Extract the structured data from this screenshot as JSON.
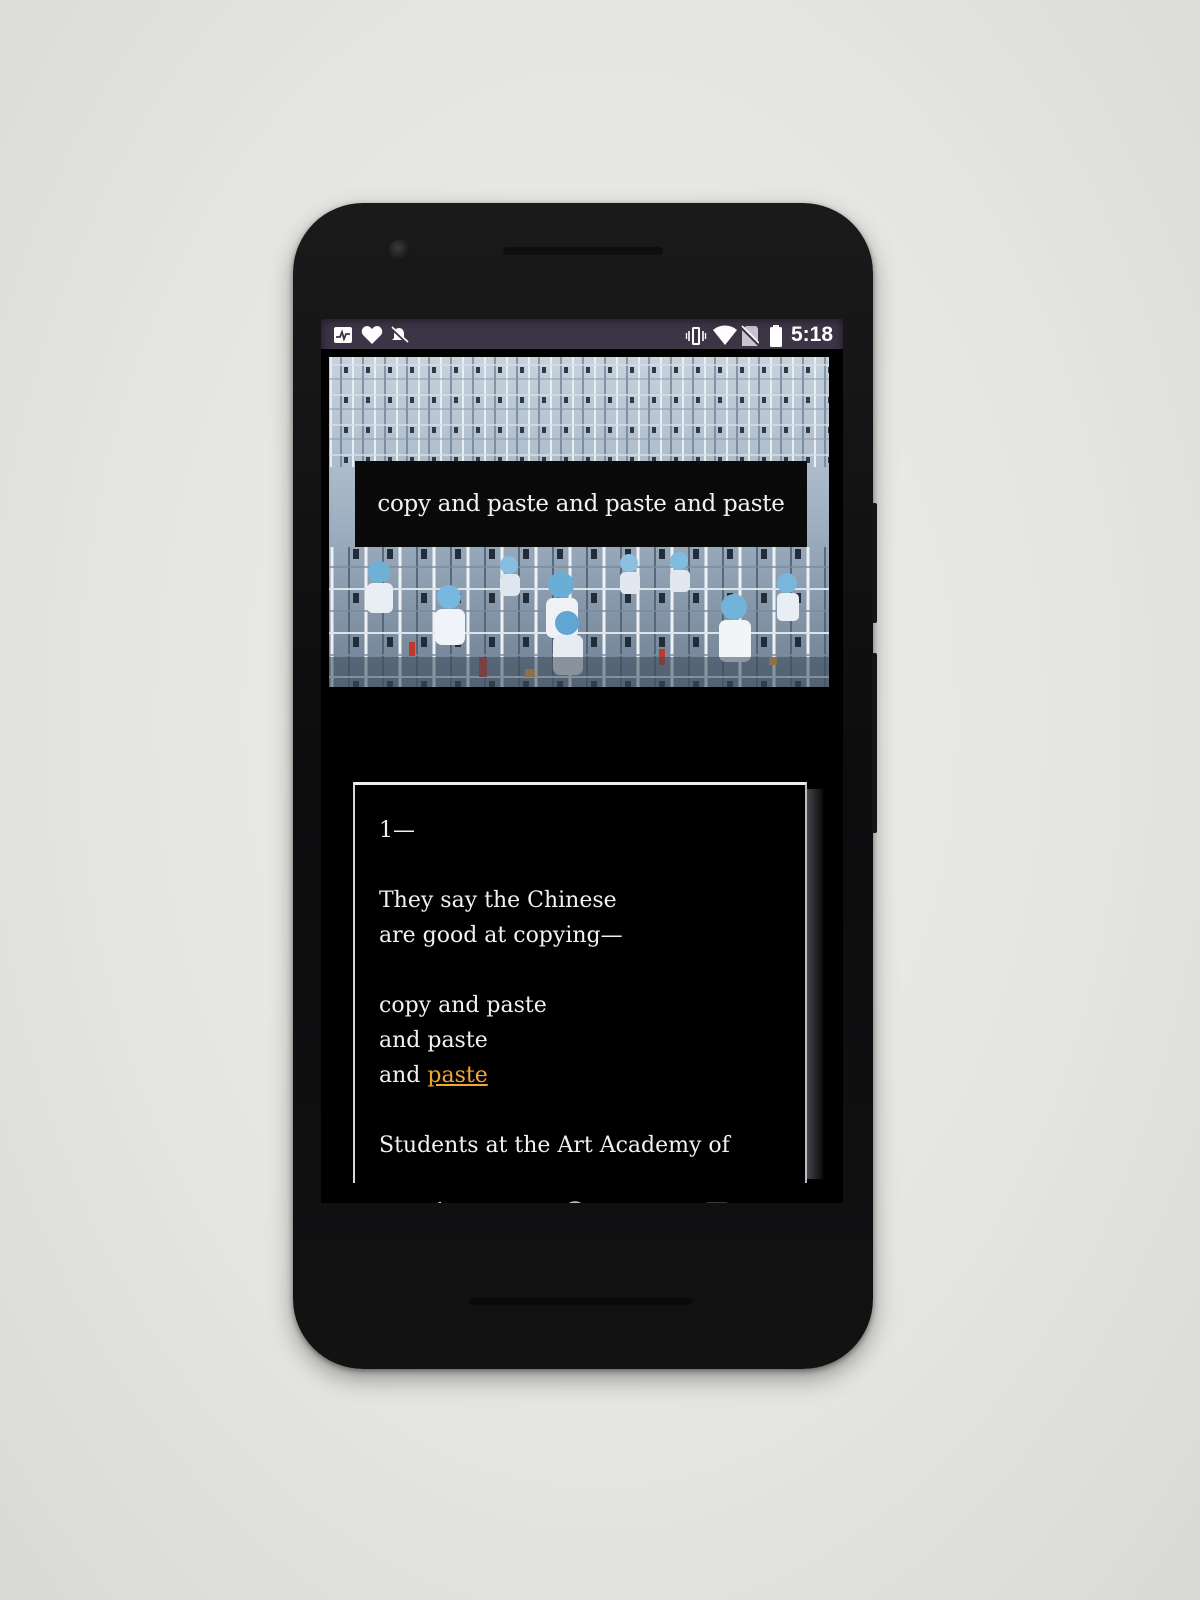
{
  "status_bar": {
    "left_icons": [
      "activity-icon",
      "heart-icon",
      "notifications-off-icon"
    ],
    "right_icons": [
      "vibrate-icon",
      "wifi-icon",
      "no-sim-icon",
      "battery-icon"
    ],
    "time": "5:18",
    "background_color": "#3b3546"
  },
  "hero": {
    "caption": "copy and paste and paste and paste"
  },
  "poem": {
    "section_number": "1—",
    "line_1": "They say the Chinese",
    "line_2": "are good at copying—",
    "line_3": "copy and paste",
    "line_4": "and paste",
    "line_5_prefix": "and ",
    "line_5_link": "paste",
    "line_6": "Students at the Art Academy of",
    "link_color": "#f0a830"
  },
  "nav_bar": {
    "icons": [
      "back-icon",
      "home-icon",
      "recents-icon"
    ]
  }
}
